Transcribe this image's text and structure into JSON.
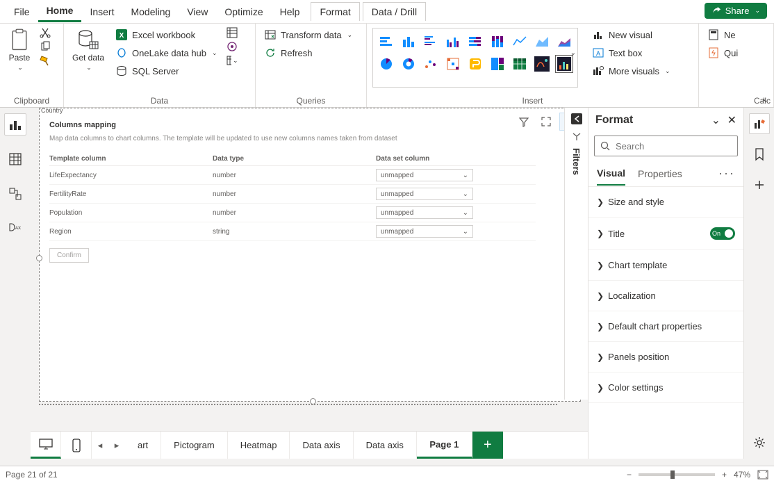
{
  "menu": {
    "file": "File",
    "home": "Home",
    "insert": "Insert",
    "modeling": "Modeling",
    "view": "View",
    "optimize": "Optimize",
    "help": "Help",
    "format": "Format",
    "datadrill": "Data / Drill",
    "share": "Share"
  },
  "ribbon": {
    "clipboard": {
      "label": "Clipboard",
      "paste": "Paste"
    },
    "data": {
      "label": "Data",
      "getdata": "Get data",
      "excel": "Excel workbook",
      "onelake": "OneLake data hub",
      "sql": "SQL Server"
    },
    "queries": {
      "label": "Queries",
      "transform": "Transform data",
      "refresh": "Refresh"
    },
    "insert": {
      "label": "Insert",
      "newvisual": "New visual",
      "textbox": "Text box",
      "more": "More visuals"
    },
    "calc": {
      "label": "Calc",
      "new": "Ne",
      "qui": "Qui"
    }
  },
  "canvas": {
    "cornerLabel": "Country",
    "mapping": {
      "title": "Columns mapping",
      "desc": "Map data columns to chart columns. The template will be updated to use new columns names taken from dataset",
      "headers": {
        "c1": "Template column",
        "c2": "Data type",
        "c3": "Data set column"
      },
      "rows": [
        {
          "name": "LifeExpectancy",
          "type": "number",
          "value": "unmapped"
        },
        {
          "name": "FertilityRate",
          "type": "number",
          "value": "unmapped"
        },
        {
          "name": "Population",
          "type": "number",
          "value": "unmapped"
        },
        {
          "name": "Region",
          "type": "string",
          "value": "unmapped"
        }
      ],
      "confirm": "Confirm"
    }
  },
  "filters": {
    "label": "Filters"
  },
  "format": {
    "title": "Format",
    "search": "Search",
    "tabs": {
      "visual": "Visual",
      "properties": "Properties"
    },
    "items": {
      "size": "Size and style",
      "title": "Title",
      "title_toggle": "On",
      "template": "Chart template",
      "local": "Localization",
      "defaults": "Default chart properties",
      "panels": "Panels position",
      "color": "Color settings"
    }
  },
  "pages": {
    "tabs": [
      "art",
      "Pictogram",
      "Heatmap",
      "Data axis",
      "Data axis",
      "Page 1"
    ]
  },
  "status": {
    "page": "Page 21 of 21",
    "zoom": "47%"
  }
}
